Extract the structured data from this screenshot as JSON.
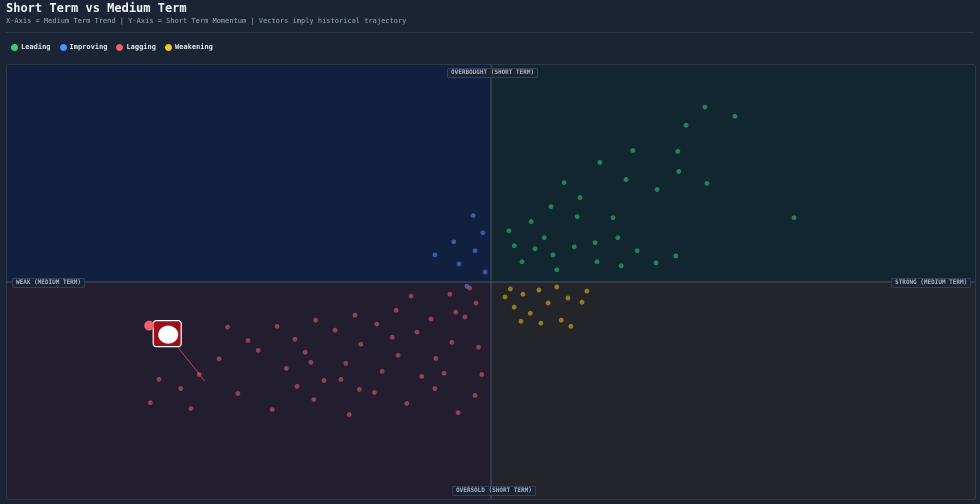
{
  "header": {
    "title": "Short Term vs Medium Term",
    "subtitle": "X-Axis = Medium Term Trend | Y-Axis = Short Term Momentum | Vectors imply historical trajectory"
  },
  "legend": [
    {
      "label": "Leading",
      "color": "#2fd47a"
    },
    {
      "label": "Improving",
      "color": "#4f8ff7"
    },
    {
      "label": "Lagging",
      "color": "#f0606a"
    },
    {
      "label": "Weakening",
      "color": "#f5c518"
    }
  ],
  "quadrant_labels": {
    "top": "OVERBOUGHT (SHORT TERM)",
    "bottom": "OVERSOLD (SHORT TERM)",
    "left": "WEAK (MEDIUM TERM)",
    "right": "STRONG (MEDIUM TERM)"
  },
  "colors": {
    "quadrant_improving": "#12203f",
    "quadrant_leading": "#112631",
    "quadrant_lagging": "#231d30",
    "quadrant_weakening": "#23252b",
    "axis_line": "#4a5568",
    "highlight": "#9b0f1c"
  },
  "chart_data": {
    "type": "scatter",
    "xlim": [
      -100,
      100
    ],
    "ylim": [
      -100,
      100
    ],
    "highlight_index": 0,
    "series": [
      {
        "name": "Lagging",
        "color": "#f0606a",
        "points": [
          {
            "x": -66.9,
            "y": -23.8,
            "tx": -59.1,
            "ty": -45.8
          },
          {
            "x": -56.2,
            "y": -35.4
          },
          {
            "x": -48.1,
            "y": -31.5
          },
          {
            "x": -42.3,
            "y": -39.8
          },
          {
            "x": -38.4,
            "y": -32.4
          },
          {
            "x": -34.5,
            "y": -45.4
          },
          {
            "x": -30.0,
            "y": -37.5
          },
          {
            "x": -26.9,
            "y": -28.7
          },
          {
            "x": -22.5,
            "y": -41.2
          },
          {
            "x": -19.2,
            "y": -33.8
          },
          {
            "x": -15.3,
            "y": -23.1
          },
          {
            "x": -11.4,
            "y": -35.2
          },
          {
            "x": -8.1,
            "y": -27.8
          },
          {
            "x": -5.4,
            "y": -16.2
          },
          {
            "x": -3.1,
            "y": -9.7
          },
          {
            "x": -19.6,
            "y": -13.0
          },
          {
            "x": -23.6,
            "y": -19.4
          },
          {
            "x": -28.1,
            "y": -15.3
          },
          {
            "x": -32.2,
            "y": -22.2
          },
          {
            "x": -36.2,
            "y": -17.6
          },
          {
            "x": -40.5,
            "y": -26.4
          },
          {
            "x": -44.2,
            "y": -20.4
          },
          {
            "x": -50.2,
            "y": -26.9
          },
          {
            "x": -54.4,
            "y": -20.8
          },
          {
            "x": -60.3,
            "y": -42.6
          },
          {
            "x": -64.1,
            "y": -49.1
          },
          {
            "x": -68.6,
            "y": -44.9
          },
          {
            "x": -70.4,
            "y": -55.6
          },
          {
            "x": -62.0,
            "y": -58.3
          },
          {
            "x": -52.3,
            "y": -51.4
          },
          {
            "x": -45.2,
            "y": -58.8
          },
          {
            "x": -36.6,
            "y": -54.2
          },
          {
            "x": -29.3,
            "y": -61.1
          },
          {
            "x": -24.1,
            "y": -50.9
          },
          {
            "x": -17.4,
            "y": -56.0
          },
          {
            "x": -11.6,
            "y": -49.1
          },
          {
            "x": -6.8,
            "y": -60.2
          },
          {
            "x": -3.3,
            "y": -52.3
          },
          {
            "x": -27.2,
            "y": -49.5
          },
          {
            "x": -14.3,
            "y": -43.5
          },
          {
            "x": -9.7,
            "y": -42.1
          },
          {
            "x": -20.4,
            "y": -25.5
          },
          {
            "x": -37.2,
            "y": -37.0
          },
          {
            "x": -12.4,
            "y": -17.1
          },
          {
            "x": -7.3,
            "y": -13.9
          },
          {
            "x": -2.6,
            "y": -30.1
          },
          {
            "x": -16.5,
            "y": -6.5
          },
          {
            "x": -8.5,
            "y": -5.6
          },
          {
            "x": -4.4,
            "y": -2.8
          },
          {
            "x": -31.0,
            "y": -44.9
          },
          {
            "x": -40.1,
            "y": -48.1
          },
          {
            "x": -1.9,
            "y": -42.6
          }
        ]
      },
      {
        "name": "Improving",
        "color": "#4f8ff7",
        "points": [
          {
            "x": -3.7,
            "y": 30.6
          },
          {
            "x": -1.7,
            "y": 22.7
          },
          {
            "x": -3.3,
            "y": 14.4
          },
          {
            "x": -1.2,
            "y": 4.6
          },
          {
            "x": -7.7,
            "y": 18.5
          },
          {
            "x": -6.6,
            "y": 8.3
          },
          {
            "x": -5.0,
            "y": -1.9
          },
          {
            "x": -11.6,
            "y": 12.5
          }
        ]
      },
      {
        "name": "Leading",
        "color": "#2fd47a",
        "points": [
          {
            "x": 44.2,
            "y": 80.6
          },
          {
            "x": 50.4,
            "y": 76.4
          },
          {
            "x": 40.3,
            "y": 72.2
          },
          {
            "x": 38.6,
            "y": 60.2
          },
          {
            "x": 29.3,
            "y": 60.6
          },
          {
            "x": 38.8,
            "y": 50.9
          },
          {
            "x": 34.3,
            "y": 42.6
          },
          {
            "x": 44.6,
            "y": 45.4
          },
          {
            "x": 27.9,
            "y": 47.2
          },
          {
            "x": 22.5,
            "y": 55.1
          },
          {
            "x": 18.4,
            "y": 38.9
          },
          {
            "x": 15.1,
            "y": 45.8
          },
          {
            "x": 12.4,
            "y": 34.7
          },
          {
            "x": 17.8,
            "y": 30.1
          },
          {
            "x": 25.2,
            "y": 29.6
          },
          {
            "x": 8.3,
            "y": 27.8
          },
          {
            "x": 11.0,
            "y": 20.4
          },
          {
            "x": 3.7,
            "y": 23.6
          },
          {
            "x": 6.4,
            "y": 9.3
          },
          {
            "x": 12.8,
            "y": 12.5
          },
          {
            "x": 17.2,
            "y": 16.2
          },
          {
            "x": 21.5,
            "y": 18.1
          },
          {
            "x": 26.2,
            "y": 20.4
          },
          {
            "x": 30.2,
            "y": 14.4
          },
          {
            "x": 26.9,
            "y": 7.4
          },
          {
            "x": 34.1,
            "y": 8.8
          },
          {
            "x": 38.2,
            "y": 12.0
          },
          {
            "x": 21.9,
            "y": 9.3
          },
          {
            "x": 13.6,
            "y": 5.6
          },
          {
            "x": 9.1,
            "y": 15.3
          },
          {
            "x": 62.6,
            "y": 29.6
          },
          {
            "x": 4.8,
            "y": 16.7
          }
        ]
      },
      {
        "name": "Weakening",
        "color": "#f5c518",
        "points": [
          {
            "x": 4.0,
            "y": -3.2
          },
          {
            "x": 6.6,
            "y": -5.6
          },
          {
            "x": 9.9,
            "y": -3.7
          },
          {
            "x": 11.8,
            "y": -9.7
          },
          {
            "x": 13.6,
            "y": -2.3
          },
          {
            "x": 15.9,
            "y": -7.4
          },
          {
            "x": 18.8,
            "y": -9.3
          },
          {
            "x": 8.1,
            "y": -14.4
          },
          {
            "x": 10.3,
            "y": -19.0
          },
          {
            "x": 14.5,
            "y": -17.6
          },
          {
            "x": 16.5,
            "y": -20.4
          },
          {
            "x": 4.8,
            "y": -11.6
          },
          {
            "x": 2.9,
            "y": -6.9
          },
          {
            "x": 6.2,
            "y": -18.1
          },
          {
            "x": 19.8,
            "y": -4.2
          }
        ]
      }
    ]
  }
}
